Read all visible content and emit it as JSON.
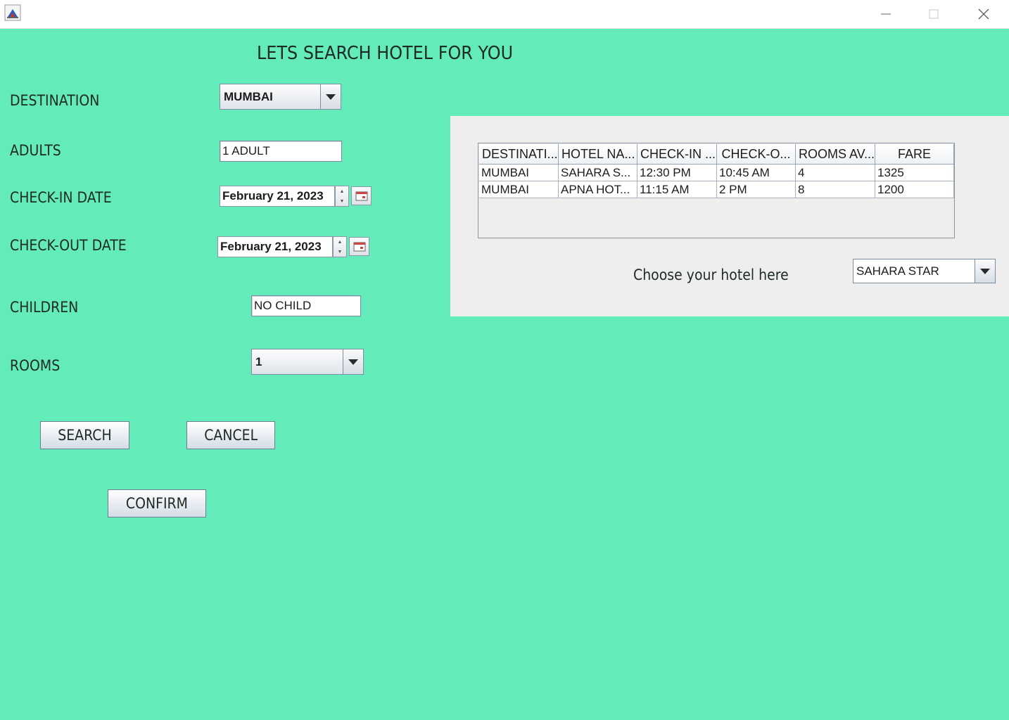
{
  "window": {
    "controls": {
      "minimize": "—",
      "maximize": "☐",
      "close": "✕"
    },
    "icon": "java-cup-icon"
  },
  "heading": "LETS SEARCH HOTEL FOR YOU",
  "form": {
    "destination_label": "DESTINATION",
    "destination_value": "MUMBAI",
    "adults_label": "ADULTS",
    "adults_value": "1 ADULT",
    "checkin_label": "CHECK-IN DATE",
    "checkin_value": "February 21, 2023",
    "checkout_label": "CHECK-OUT DATE",
    "checkout_value": "February 21, 2023",
    "children_label": "CHILDREN",
    "children_value": "NO CHILD",
    "rooms_label": "ROOMS",
    "rooms_value": "1"
  },
  "buttons": {
    "search": "SEARCH",
    "cancel": "CANCEL",
    "confirm": "CONFIRM"
  },
  "results": {
    "columns": [
      "DESTINATI...",
      "HOTEL NA...",
      "CHECK-IN ...",
      "CHECK-O...",
      "ROOMS AV...",
      "FARE"
    ],
    "rows": [
      [
        "MUMBAI",
        "SAHARA S...",
        "12:30 PM",
        "10:45 AM",
        "4",
        "1325"
      ],
      [
        "MUMBAI",
        "APNA HOT...",
        "11:15 AM",
        "2 PM",
        "8",
        "1200"
      ]
    ],
    "choose_label": "Choose your hotel here",
    "hotel_value": "SAHARA STAR"
  },
  "colors": {
    "background": "#63ebb9",
    "panel": "#eeeeee"
  }
}
